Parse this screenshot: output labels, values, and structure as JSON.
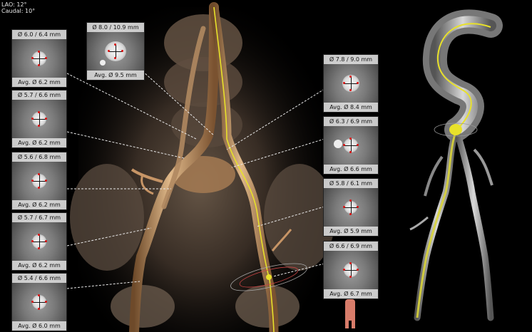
{
  "orientation": {
    "line1": "LAO: 12°",
    "line2": "Caudal: 10°"
  },
  "colors": {
    "background": "#000000",
    "centerline": "#e8e12a",
    "vessel_3d": "#c9a070",
    "measure_mark": "#dd1111",
    "panel_label_bg": "#e6e6e6"
  },
  "left_panels": [
    {
      "diameter": "Ø 6.0 / 6.4 mm",
      "average": "Avg. Ø 6.2 mm"
    },
    {
      "diameter": "Ø 5.7 / 6.6 mm",
      "average": "Avg. Ø 6.2 mm"
    },
    {
      "diameter": "Ø 5.6 / 6.8 mm",
      "average": "Avg. Ø 6.2 mm"
    },
    {
      "diameter": "Ø 5.7 / 6.7 mm",
      "average": "Avg. Ø 6.2 mm"
    },
    {
      "diameter": "Ø 5.4 / 6.6 mm",
      "average": "Avg. Ø 6.0 mm"
    }
  ],
  "top_panel": {
    "diameter": "Ø 8.0 / 10.9 mm",
    "average": "Avg. Ø 9.5 mm"
  },
  "right_panels": [
    {
      "diameter": "Ø 7.8 / 9.0 mm",
      "average": "Avg. Ø 8.4 mm"
    },
    {
      "diameter": "Ø 6.3 / 6.9 mm",
      "average": "Avg. Ø 6.6 mm"
    },
    {
      "diameter": "Ø 5.8 / 6.1 mm",
      "average": "Avg. Ø 5.9 mm"
    },
    {
      "diameter": "Ø 6.6 / 6.9 mm",
      "average": "Avg. Ø 6.7 mm"
    }
  ],
  "icons": {
    "crosshair": "measurement-crosshair-icon",
    "body_orientation": "body-figure-icon"
  }
}
